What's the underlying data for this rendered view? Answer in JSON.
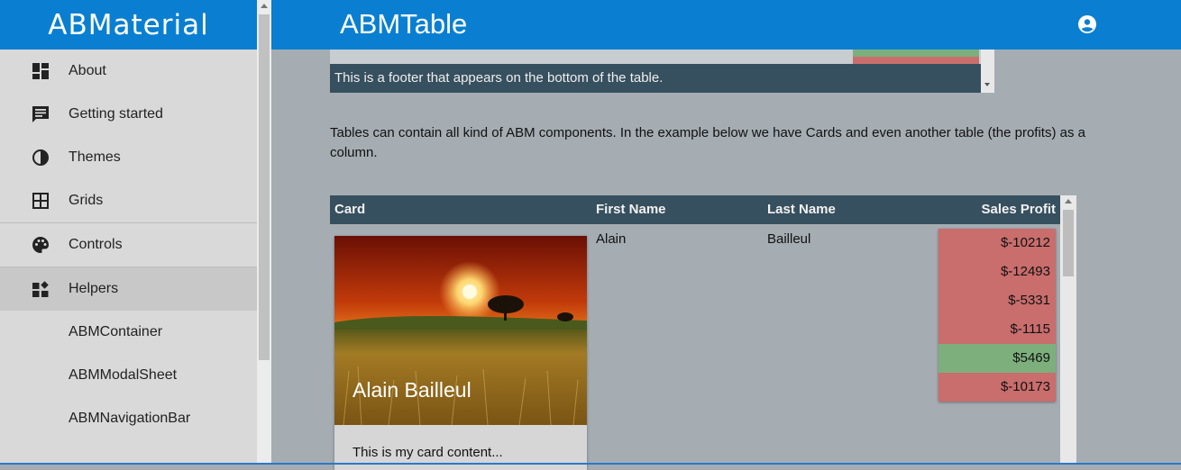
{
  "brand": "ABMaterial",
  "topbar": {
    "title": "ABMTable"
  },
  "sidebar": {
    "items": [
      {
        "label": "About",
        "icon": "dashboard-icon"
      },
      {
        "label": "Getting started",
        "icon": "chat-icon"
      },
      {
        "label": "Themes",
        "icon": "contrast-icon"
      },
      {
        "label": "Grids",
        "icon": "grid-icon"
      },
      {
        "label": "Controls",
        "icon": "palette-icon"
      },
      {
        "label": "Helpers",
        "icon": "widgets-icon"
      },
      {
        "label": "ABMContainer",
        "icon": ""
      },
      {
        "label": "ABMModalSheet",
        "icon": ""
      },
      {
        "label": "ABMNavigationBar",
        "icon": ""
      }
    ]
  },
  "table1": {
    "footer": "This is a footer that appears on the bottom of the table."
  },
  "intro_text": "Tables can contain all kind of ABM components. In the example below we have Cards and even another table (the profits) as a column.",
  "table2": {
    "headers": [
      "Card",
      "First Name",
      "Last Name",
      "Sales Profit"
    ],
    "rows": [
      {
        "card_title": "Alain Bailleul",
        "card_content": "This is my card content...",
        "first_name": "Alain",
        "last_name": "Bailleul",
        "profits": [
          {
            "value": "$-10212",
            "status": "negative"
          },
          {
            "value": "$-12493",
            "status": "negative"
          },
          {
            "value": "$-5331",
            "status": "negative"
          },
          {
            "value": "$-1115",
            "status": "negative"
          },
          {
            "value": "$5469",
            "status": "positive"
          },
          {
            "value": "$-10173",
            "status": "negative"
          }
        ]
      }
    ]
  },
  "colors": {
    "primary": "#0a7fd1",
    "table_header": "#37505f",
    "positive": "#7daf7d",
    "negative": "#c96d6d"
  }
}
